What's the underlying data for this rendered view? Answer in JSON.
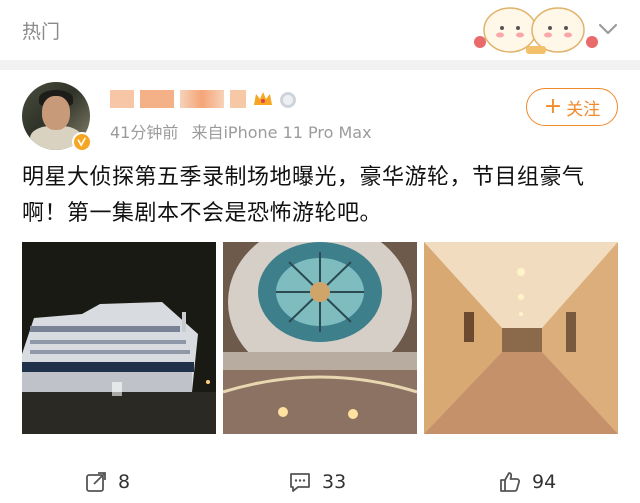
{
  "header": {
    "title": "热门"
  },
  "post": {
    "meta": {
      "time": "41分钟前",
      "source": "来自iPhone 11 Pro Max"
    },
    "follow_label": "关注",
    "text": "明星大侦探第五季录制场地曝光，豪华游轮，节目组豪气啊！第一集剧本不会是恐怖游轮吧。",
    "images": [
      "cruise-ship-night",
      "ship-atrium-glass-dome",
      "ship-corridor"
    ]
  },
  "actions": {
    "repost_count": "8",
    "comment_count": "33",
    "like_count": "94"
  },
  "colors": {
    "accent": "#f08a2b",
    "muted": "#9b9b9b",
    "badge": "#f5a623"
  }
}
